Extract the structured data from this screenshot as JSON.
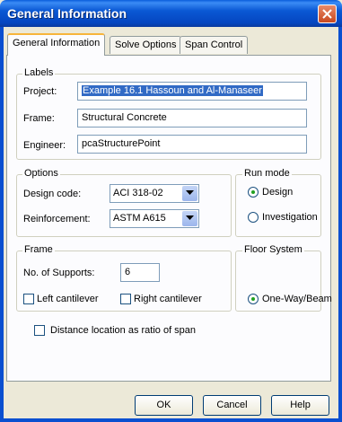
{
  "window": {
    "title": "General Information"
  },
  "tabs": [
    {
      "label": "General Information"
    },
    {
      "label": "Solve Options"
    },
    {
      "label": "Span Control"
    }
  ],
  "labels_group": {
    "legend": "Labels",
    "project": {
      "label": "Project:",
      "value": "Example 16.1 Hassoun and Al-Manaseer"
    },
    "frame": {
      "label": "Frame:",
      "value": "Structural Concrete"
    },
    "engineer": {
      "label": "Engineer:",
      "value": "pcaStructurePoint"
    }
  },
  "options_group": {
    "legend": "Options",
    "design_code": {
      "label": "Design code:",
      "value": "ACI 318-02"
    },
    "reinforcement": {
      "label": "Reinforcement:",
      "value": "ASTM A615"
    }
  },
  "run_mode": {
    "legend": "Run mode",
    "design": {
      "label": "Design",
      "checked": true
    },
    "investigation": {
      "label": "Investigation",
      "checked": false
    }
  },
  "frame_group": {
    "legend": "Frame",
    "supports": {
      "label": "No. of Supports:",
      "value": "6"
    },
    "left_cantilever": {
      "label": "Left cantilever",
      "checked": false
    },
    "right_cantilever": {
      "label": "Right cantilever",
      "checked": false
    }
  },
  "floor_system": {
    "legend": "Floor System",
    "one_way_beam": {
      "label": "One-Way/Beam",
      "checked": true
    }
  },
  "distance_ratio": {
    "label": "Distance location as ratio of span",
    "checked": false
  },
  "buttons": {
    "ok": "OK",
    "cancel": "Cancel",
    "help": "Help"
  },
  "colors": {
    "title_bar": "#0a5ddb",
    "selection": "#316ac5",
    "tab_highlight": "#f7b53b"
  }
}
